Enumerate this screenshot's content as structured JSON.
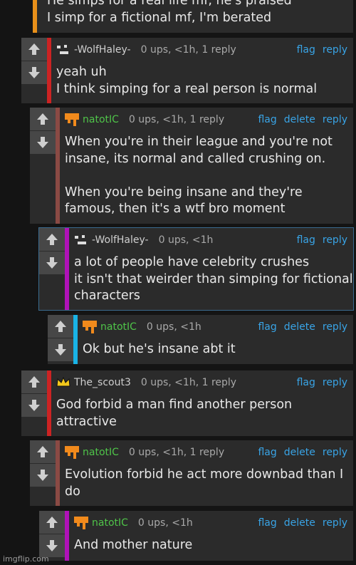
{
  "colors": {
    "link": "#39a4e6",
    "meta": "#a9a9a9",
    "natot_name": "#4fc449",
    "bar_orange": "#e8901a",
    "bar_red": "#cc2323",
    "bar_brown": "#8a4a44",
    "bar_magenta": "#b012b8",
    "bar_cyan": "#19b3e6"
  },
  "top_comment": {
    "text": "He simps for a real life mf, he's praised\nI simp for a fictional mf, I'm berated"
  },
  "comments": [
    {
      "username": "-WolfHaley-",
      "meta": "0 ups, <1h, 1 reply",
      "actions": [
        "flag",
        "reply"
      ],
      "text": "yeah uh\nI think simping for a real person is normal"
    },
    {
      "username": "natotIC",
      "meta": "0 ups, <1h, 1 reply",
      "actions": [
        "flag",
        "delete",
        "reply"
      ],
      "text": "When you're in their league and you're not insane, its normal and called crushing on.\n\nWhen you're being insane and they're famous, then it's a wtf bro moment"
    },
    {
      "username": "-WolfHaley-",
      "meta": "0 ups, <1h",
      "actions": [
        "flag",
        "reply"
      ],
      "text": "a lot of people have celebrity crushes\nit isn't that weirder than simping for fictional characters"
    },
    {
      "username": "natotIC",
      "meta": "0 ups, <1h",
      "actions": [
        "flag",
        "delete",
        "reply"
      ],
      "text": "Ok but he's insane abt it"
    },
    {
      "username": "The_scout3",
      "meta": "0 ups, <1h, 1 reply",
      "actions": [
        "flag",
        "reply"
      ],
      "text": "God forbid a man find another person attractive"
    },
    {
      "username": "natotIC",
      "meta": "0 ups, <1h, 1 reply",
      "actions": [
        "flag",
        "delete",
        "reply"
      ],
      "text": "Evolution forbid he act more downbad than I do"
    },
    {
      "username": "natotIC",
      "meta": "0 ups, <1h",
      "actions": [
        "flag",
        "delete",
        "reply"
      ],
      "text": "And mother nature"
    }
  ],
  "footer": {
    "watermark": "imgflip.com"
  }
}
